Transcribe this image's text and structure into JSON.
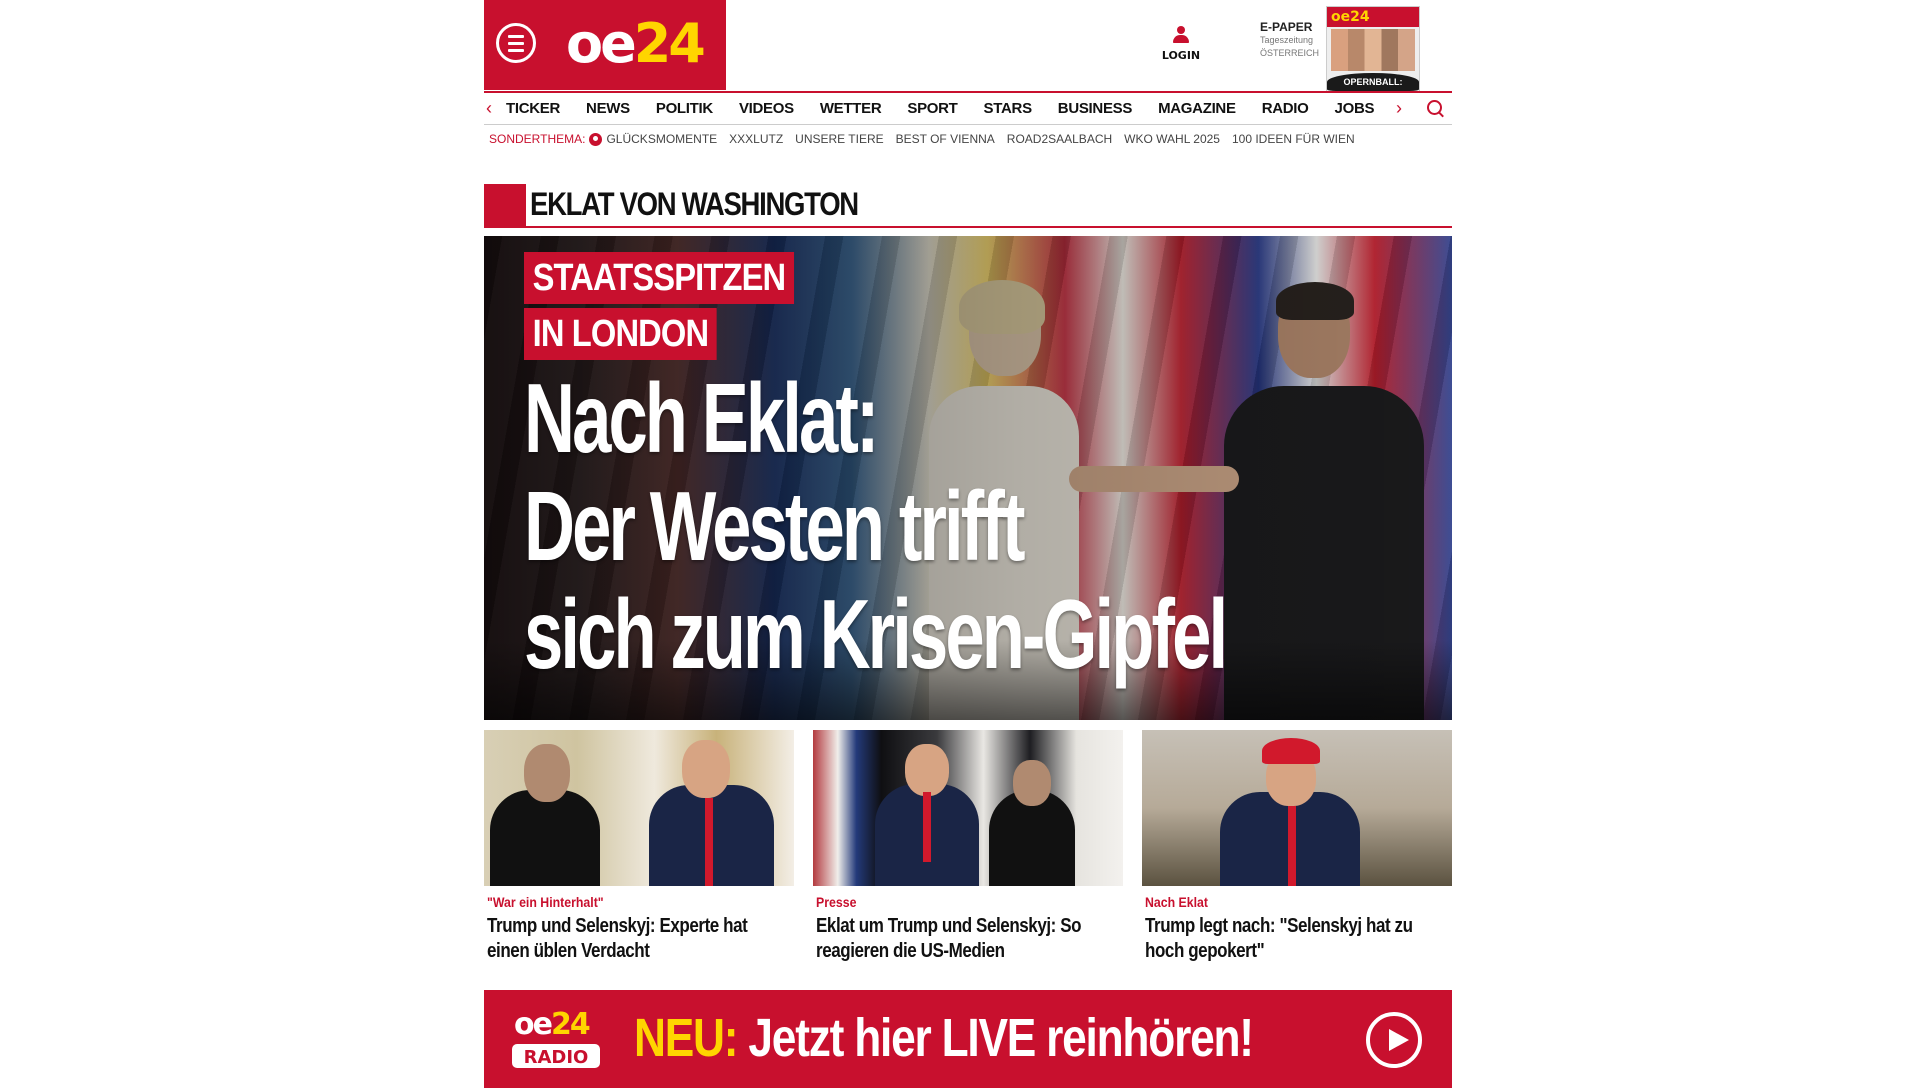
{
  "header": {
    "logo": {
      "part1": "oe",
      "part2": "24"
    },
    "login_label": "LOGIN",
    "epaper": {
      "title": "E-PAPER",
      "line1": "Tageszeitung",
      "line2": "ÖSTERREICH",
      "cover_logo": "oe24",
      "cover_caption": "OPERNBALL: Models statt Mörtel"
    }
  },
  "nav": {
    "items": [
      "TICKER",
      "NEWS",
      "POLITIK",
      "VIDEOS",
      "WETTER",
      "SPORT",
      "STARS",
      "BUSINESS",
      "MAGAZINE",
      "RADIO",
      "JOBS"
    ],
    "left_arrow": "‹",
    "right_arrow": "›"
  },
  "sonderthema": {
    "lead": "SONDERTHEMA:",
    "items": [
      "GLÜCKSMOMENTE",
      "XXXLUTZ",
      "UNSERE TIERE",
      "BEST OF VIENNA",
      "ROAD2SAALBACH",
      "WKO WAHL 2025",
      "100 IDEEN FÜR WIEN"
    ]
  },
  "section": {
    "title": "EKLAT VON WASHINGTON"
  },
  "hero": {
    "kicker_line1": "STAATSSPITZEN",
    "kicker_line2": "IN LONDON",
    "headline_lines": [
      "Nach Eklat:",
      "Der Westen trifft",
      "sich zum Krisen-Gipfel"
    ]
  },
  "teasers": [
    {
      "category": "\"War ein Hinterhalt\"",
      "title": "Trump und Selenskyj: Experte hat einen üblen Verdacht"
    },
    {
      "category": "Presse",
      "title": "Eklat um Trump und Selenskyj: So reagieren die US-Medien"
    },
    {
      "category": "Nach Eklat",
      "title": "Trump legt nach: \"Selenskyj hat zu hoch gepokert\""
    }
  ],
  "radio_banner": {
    "logo_top": "oe24",
    "logo_bottom": "RADIO",
    "new_label": "NEU:",
    "message": "Jetzt hier LIVE reinhören!"
  },
  "colors": {
    "brand_red": "#c8102e",
    "accent_yellow": "#ffd500"
  }
}
